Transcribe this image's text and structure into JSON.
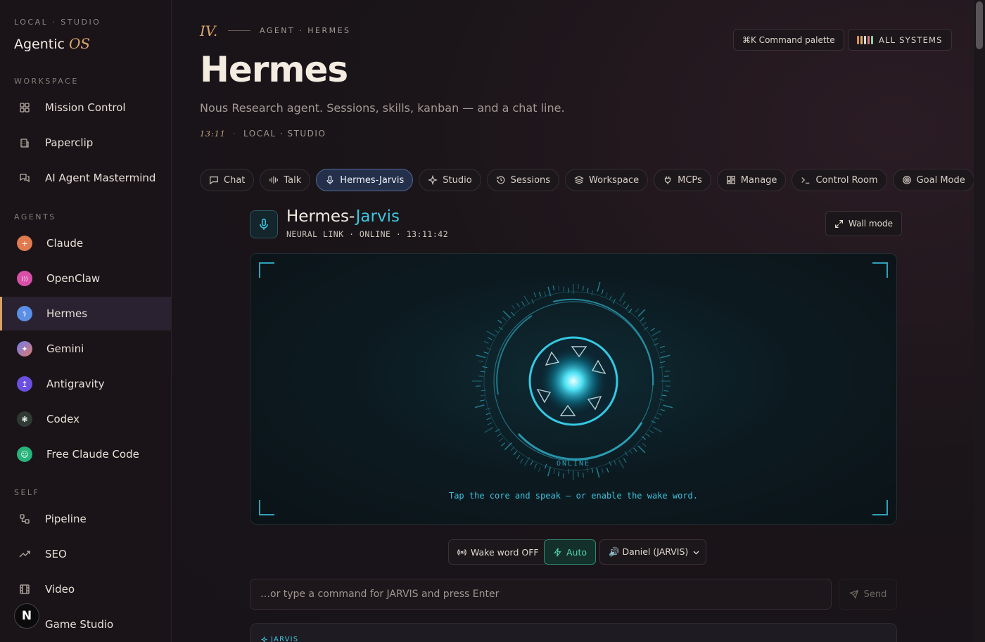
{
  "brand": {
    "eyebrow": "LOCAL · STUDIO",
    "name": "Agentic",
    "suffix": "OS"
  },
  "sidebar": {
    "workspace_label": "WORKSPACE",
    "workspace": [
      {
        "label": "Mission Control",
        "icon": "grid-icon"
      },
      {
        "label": "Paperclip",
        "icon": "building-icon"
      },
      {
        "label": "AI Agent Mastermind",
        "icon": "chat-icon"
      }
    ],
    "agents_label": "AGENTS",
    "agents": [
      {
        "label": "Claude",
        "color": "#e07a4f",
        "glyph": "+"
      },
      {
        "label": "OpenClaw",
        "color": "#d94fa8",
        "glyph": ")))"
      },
      {
        "label": "Hermes",
        "color": "#5b8fe6",
        "glyph": "⚕",
        "active": true
      },
      {
        "label": "Gemini",
        "color": "#c66ad9",
        "glyph": "✦"
      },
      {
        "label": "Antigravity",
        "color": "#6b4fe0",
        "glyph": "↥"
      },
      {
        "label": "Codex",
        "color": "#2f3a34",
        "glyph": "❃"
      },
      {
        "label": "Free Claude Code",
        "color": "#27b47b",
        "glyph": "☺"
      }
    ],
    "self_label": "SELF",
    "self": [
      {
        "label": "Pipeline",
        "icon": "pipeline-icon"
      },
      {
        "label": "SEO",
        "icon": "trend-icon"
      },
      {
        "label": "Video",
        "icon": "film-icon"
      },
      {
        "label": "Game Studio",
        "icon": "gamepad-icon"
      }
    ],
    "avatar_letter": "N"
  },
  "header": {
    "numeral": "IV.",
    "eyebrow": "AGENT · HERMES",
    "title": "Hermes",
    "subtitle": "Nous Research agent. Sessions, skills, kanban — and a chat line.",
    "time": "13:11",
    "location": "LOCAL · STUDIO",
    "command_palette": "⌘K  Command palette",
    "systems": "ALL SYSTEMS",
    "systems_colors": [
      "#e08a5a",
      "#e0b45a",
      "#d9d9d9",
      "#e07a7a",
      "#8fd0a0"
    ]
  },
  "tabs": [
    {
      "label": "Chat",
      "icon": "chat-bubble-icon"
    },
    {
      "label": "Talk",
      "icon": "waveform-icon"
    },
    {
      "label": "Hermes-Jarvis",
      "icon": "microphone-icon",
      "active": true
    },
    {
      "label": "Studio",
      "icon": "sparkle-icon"
    },
    {
      "label": "Sessions",
      "icon": "history-icon"
    },
    {
      "label": "Workspace",
      "icon": "layers-icon"
    },
    {
      "label": "MCPs",
      "icon": "plug-icon"
    },
    {
      "label": "Manage",
      "icon": "dashboard-icon"
    },
    {
      "label": "Control Room",
      "icon": "terminal-icon"
    },
    {
      "label": "Goal Mode",
      "icon": "target-icon"
    }
  ],
  "jarvis": {
    "title_prefix": "Hermes-",
    "title_accent": "Jarvis",
    "status": "NEURAL LINK · ONLINE · 13:11:42",
    "wall_mode": "Wall mode",
    "core_state": "ONLINE",
    "hint": "Tap the core and speak — or enable the wake word.",
    "accent_color": "#3ec6e0"
  },
  "controls": {
    "wake_word": "Wake word OFF",
    "auto": "Auto",
    "voice_selected": "🔊 Daniel (JARVIS)"
  },
  "command": {
    "placeholder": "…or type a command for JARVIS and press Enter",
    "value": "",
    "send": "Send"
  },
  "log": {
    "label": "JARVIS"
  }
}
